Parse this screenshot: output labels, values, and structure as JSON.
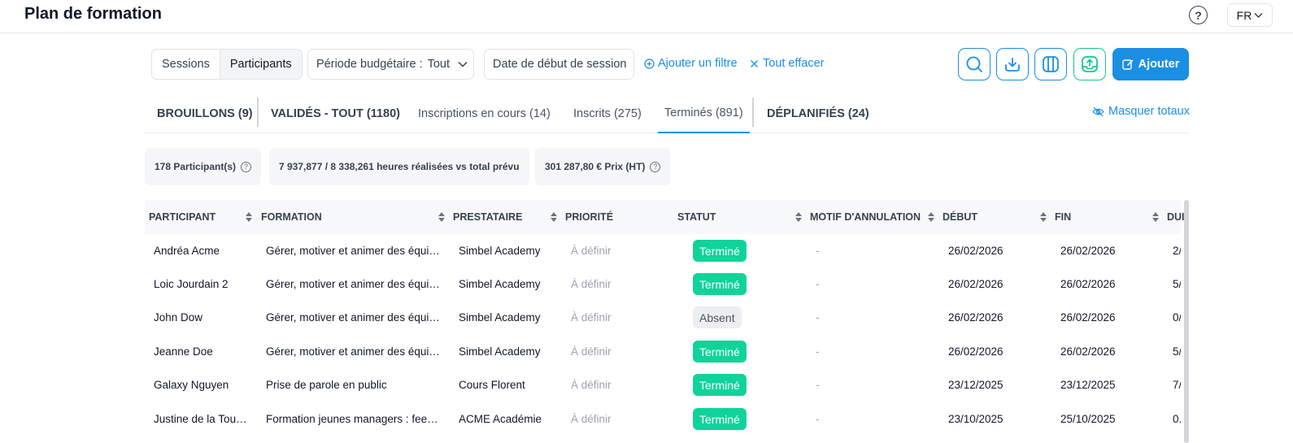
{
  "header": {
    "title": "Plan de formation",
    "help_icon": "question-circle-icon",
    "lang": "FR"
  },
  "toolbar": {
    "view_toggle": [
      "Sessions",
      "Participants"
    ],
    "budget_filter": "Période budgétaire :",
    "budget_value": "Tout",
    "date_filter": "Date de début de session",
    "add_filter": "Ajouter un filtre",
    "clear_all": "Tout effacer",
    "icon_buttons": [
      "search-icon",
      "download-icon",
      "columns-icon",
      "export-icon"
    ],
    "add_button": "Ajouter",
    "accent_color": "#1a8fe3",
    "green_color": "#10d39a"
  },
  "tabs": [
    "BROUILLONS (9)",
    "VALIDÉS - TOUT (1180)",
    "Inscriptions en cours (14)",
    "Inscrits (275)",
    "Terminés (891)",
    "DÉPLANIFIÉS (24)"
  ],
  "hide_totals": "Masquer totaux",
  "stats": [
    "178 Participant(s)",
    "7 937,877 / 8 338,261 heures réalisées vs total prévu",
    "301 287,80 € Prix (HT)"
  ],
  "table": {
    "columns": [
      "PARTICIPANT",
      "FORMATION",
      "PRESTATAIRE",
      "PRIORITÉ",
      "STATUT",
      "MOTIF D'ANNULATION",
      "DÉBUT",
      "FIN",
      "DUI"
    ],
    "rows": [
      [
        "Andréa Acme",
        "Gérer, motiver et animer des équi…",
        "Simbel Academy",
        "À définir",
        "Terminé",
        "-",
        "26/02/2026",
        "26/02/2026",
        "2/"
      ],
      [
        "Loic Jourdain 2",
        "Gérer, motiver et animer des équi…",
        "Simbel Academy",
        "À définir",
        "Terminé",
        "-",
        "26/02/2026",
        "26/02/2026",
        "5/"
      ],
      [
        "John Dow",
        "Gérer, motiver et animer des équi…",
        "Simbel Academy",
        "À définir",
        "Absent",
        "-",
        "26/02/2026",
        "26/02/2026",
        "0/"
      ],
      [
        "Jeanne Doe",
        "Gérer, motiver et animer des équi…",
        "Simbel Academy",
        "À définir",
        "Terminé",
        "-",
        "26/02/2026",
        "26/02/2026",
        "5/"
      ],
      [
        "Galaxy Nguyen",
        "Prise de parole en public",
        "Cours Florent",
        "À définir",
        "Terminé",
        "-",
        "23/12/2025",
        "23/12/2025",
        "7/"
      ],
      [
        "Justine de la Tou…",
        "Formation jeunes managers : fee…",
        "ACME Académie",
        "À définir",
        "Terminé",
        "-",
        "23/10/2025",
        "25/10/2025",
        "0.:"
      ]
    ]
  }
}
